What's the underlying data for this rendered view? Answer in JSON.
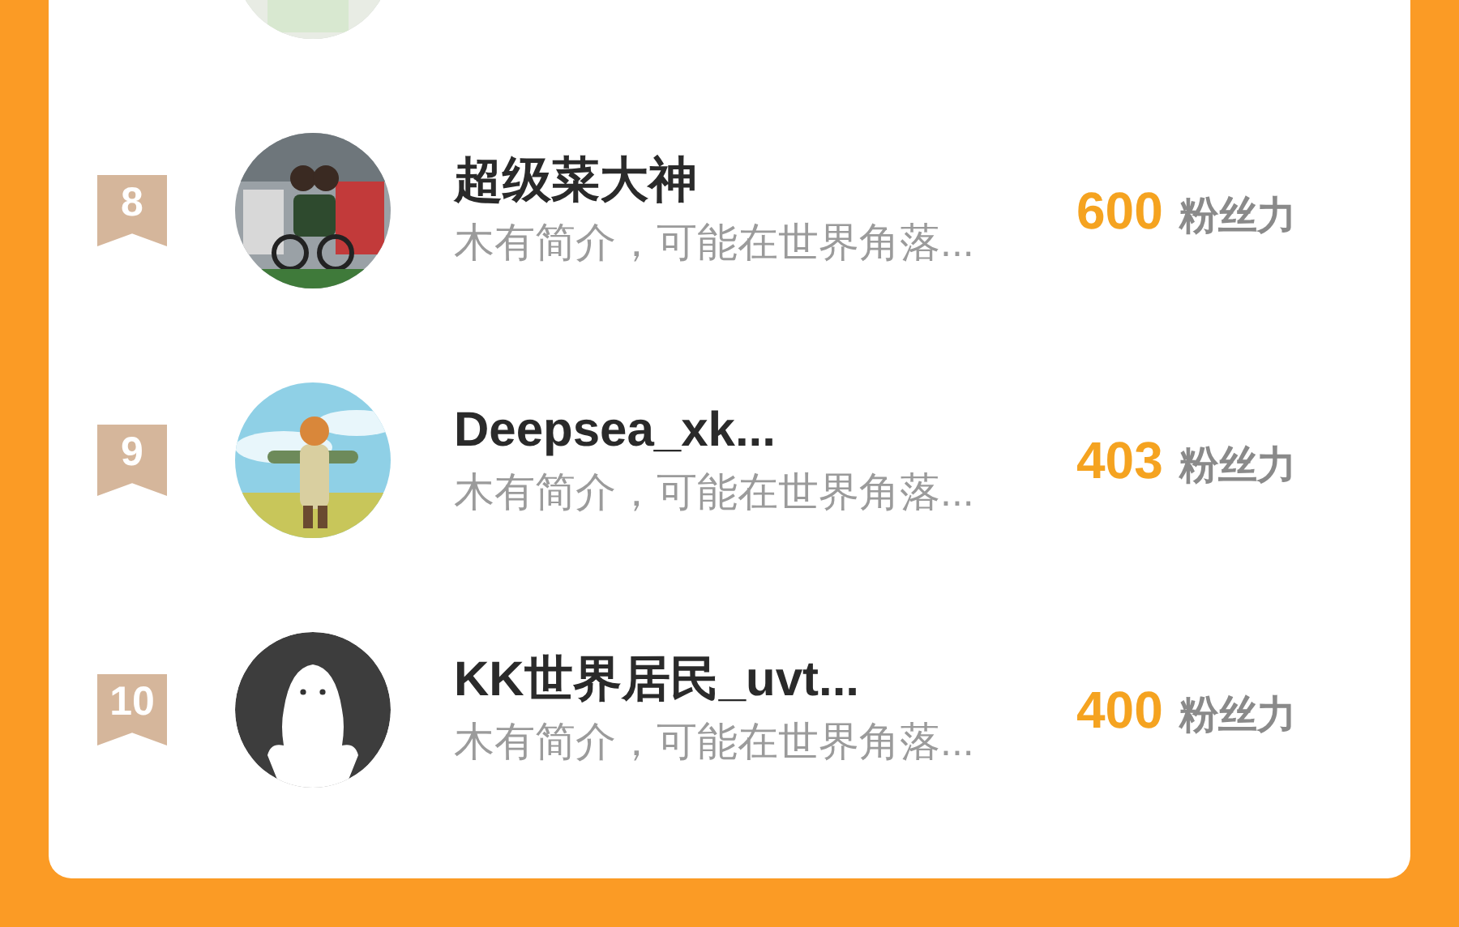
{
  "ranking": [
    {
      "avatar": {
        "kind": "picture"
      }
    },
    {
      "rank": "8",
      "avatar": {
        "kind": "picture"
      },
      "name": "超级菜大神",
      "bio": "木有简介，可能在世界角落...",
      "score": "600",
      "unit": "粉丝力"
    },
    {
      "rank": "9",
      "avatar": {
        "kind": "picture"
      },
      "name": "Deepsea_xk...",
      "bio": "木有简介，可能在世界角落...",
      "score": "403",
      "unit": "粉丝力"
    },
    {
      "rank": "10",
      "avatar": {
        "kind": "default"
      },
      "name": "KK世界居民_uvt...",
      "bio": "木有简介，可能在世界角落...",
      "score": "400",
      "unit": "粉丝力"
    }
  ]
}
